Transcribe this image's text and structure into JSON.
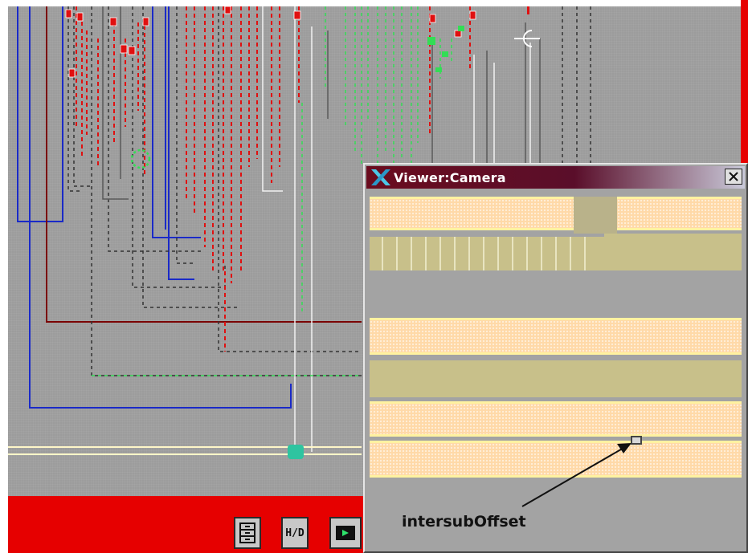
{
  "viewer": {
    "title": "Viewer:Camera",
    "close_label": "close",
    "annotation": "intersubOffset"
  },
  "toolbar": {
    "buttons": [
      {
        "name": "stack-icon",
        "label": ""
      },
      {
        "name": "half-divide-icon",
        "label": "H/D"
      },
      {
        "name": "camera-icon",
        "label": ""
      }
    ]
  },
  "colors": {
    "canvas": "#9c9c9c",
    "red_net": "#e01010",
    "green_net": "#33dd55",
    "blue_net": "#1a2ac8",
    "dark_red_net": "#7a0000",
    "metal_fill": "#ffd9a8",
    "metal_edge": "#fff2a0",
    "khaki_fill": "#c8c08a",
    "title_bar": "#5a0e2a",
    "accent_red": "#e60000"
  }
}
